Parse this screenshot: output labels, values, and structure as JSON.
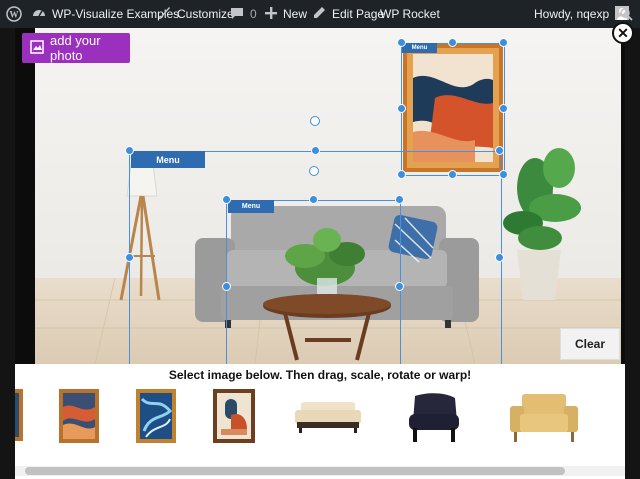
{
  "admin_bar": {
    "site_name": "WP-Visualize Examples",
    "customize": "Customize",
    "comments_count": "0",
    "new_label": "New",
    "edit_page": "Edit Page",
    "wp_rocket": "WP Rocket",
    "howdy": "Howdy, nqexp"
  },
  "visualizer": {
    "add_photo_label": "add your photo",
    "close_symbol": "✕",
    "clear_label": "Clear",
    "instruction": "Select image below. Then drag, scale, rotate or warp!",
    "menu_tags": [
      "Menu",
      "Menu",
      "Menu"
    ],
    "thumbnails": [
      "framed-art-partial",
      "framed-abstract-waves",
      "framed-blue-marble",
      "framed-abstract-shapes",
      "cream-sofa",
      "navy-armchair",
      "tan-armchair"
    ]
  },
  "colors": {
    "admin_bg": "#1d2327",
    "photo_btn": "#9b2fbe",
    "handle": "#3b8fe0",
    "menu_tag": "#2f6bb0"
  }
}
